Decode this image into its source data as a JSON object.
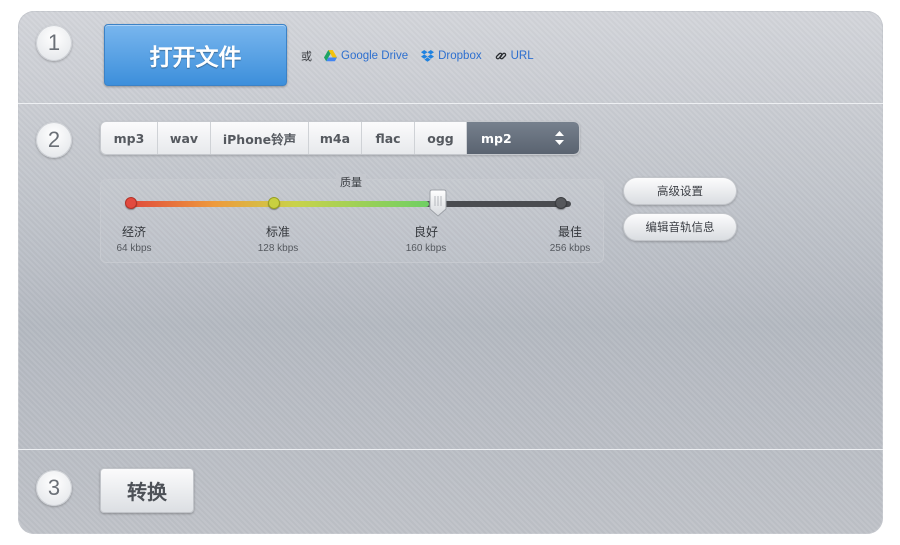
{
  "steps": {
    "one": "1",
    "two": "2",
    "three": "3"
  },
  "open": {
    "button_label": "打开文件",
    "or_text": "或",
    "sources": [
      {
        "label": "Google Drive",
        "icon": "google-drive-icon"
      },
      {
        "label": "Dropbox",
        "icon": "dropbox-icon"
      },
      {
        "label": "URL",
        "icon": "link-icon"
      }
    ]
  },
  "formats": {
    "tabs": [
      "mp3",
      "wav",
      "iPhone铃声",
      "m4a",
      "flac",
      "ogg"
    ],
    "selected": "mp2"
  },
  "quality": {
    "title": "质量",
    "levels": [
      {
        "name": "经济",
        "rate": "64 kbps",
        "color": "#e24a3f"
      },
      {
        "name": "标准",
        "rate": "128 kbps",
        "color": "#c8d040"
      },
      {
        "name": "良好",
        "rate": "160 kbps",
        "color": "#6ccc5f"
      },
      {
        "name": "最佳",
        "rate": "256 kbps",
        "color": "#56585c"
      }
    ],
    "selected_index": 2
  },
  "side_buttons": {
    "advanced": "高级设置",
    "edit_tags": "编辑音轨信息"
  },
  "convert": {
    "label": "转换"
  },
  "colors": {
    "accent": "#3d8fdb",
    "link": "#2d6fcf"
  }
}
